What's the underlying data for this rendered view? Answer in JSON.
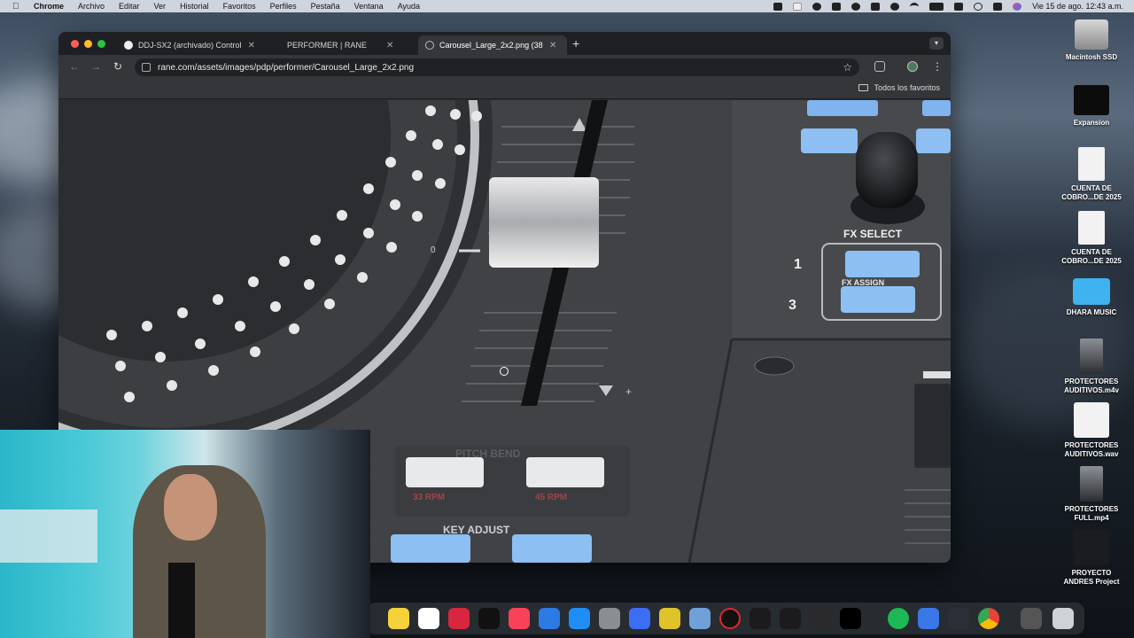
{
  "menubar": {
    "app": "Chrome",
    "items": [
      "Archivo",
      "Editar",
      "Ver",
      "Historial",
      "Favoritos",
      "Perfiles",
      "Pestaña",
      "Ventana",
      "Ayuda"
    ],
    "clock": "Vie 15 de ago.  12:43 a.m."
  },
  "browser": {
    "tabs": [
      {
        "title": "DDJ-SX2 (archivado) Control",
        "icon": "pioneer-dj-icon"
      },
      {
        "title": "PERFORMER | RANE",
        "icon": "rane-icon"
      },
      {
        "title": "Carousel_Large_2x2.png (38",
        "icon": "globe-icon"
      }
    ],
    "url": "rane.com/assets/images/pdp/performer/Carousel_Large_2x2.png",
    "bookmarks_label": "Todos los favoritos"
  },
  "image_labels": {
    "fx_select": "FX SELECT",
    "fx_assign": "FX ASSIGN",
    "pitch_bend": "PITCH BEND",
    "key_adjust": "KEY ADJUST",
    "rpm_33": "33 RPM",
    "rpm_45": "45 RPM",
    "deck_1": "1",
    "deck_3": "3",
    "zero_mark": "0"
  },
  "desktop_icons": [
    {
      "label": "Macintosh SSD",
      "icon": "hard-drive-icon"
    },
    {
      "label": "Expansion",
      "icon": "external-drive-icon"
    },
    {
      "label": "CUENTA DE COBRO...DE 2025",
      "icon": "pdf-file-icon"
    },
    {
      "label": "CUENTA DE COBRO...DE 2025",
      "icon": "pdf-file-icon"
    },
    {
      "label": "DHARA MUSIC",
      "icon": "folder-icon"
    },
    {
      "label": "PROTECTORES AUDITIVOS.m4v",
      "icon": "video-file-icon"
    },
    {
      "label": "PROTECTORES AUDITIVOS.wav",
      "icon": "audio-file-icon"
    },
    {
      "label": "PROTECTORES FULL.mp4",
      "icon": "video-file-icon"
    },
    {
      "label": "PROYECTO ANDRES Project",
      "icon": "project-file-icon"
    }
  ]
}
